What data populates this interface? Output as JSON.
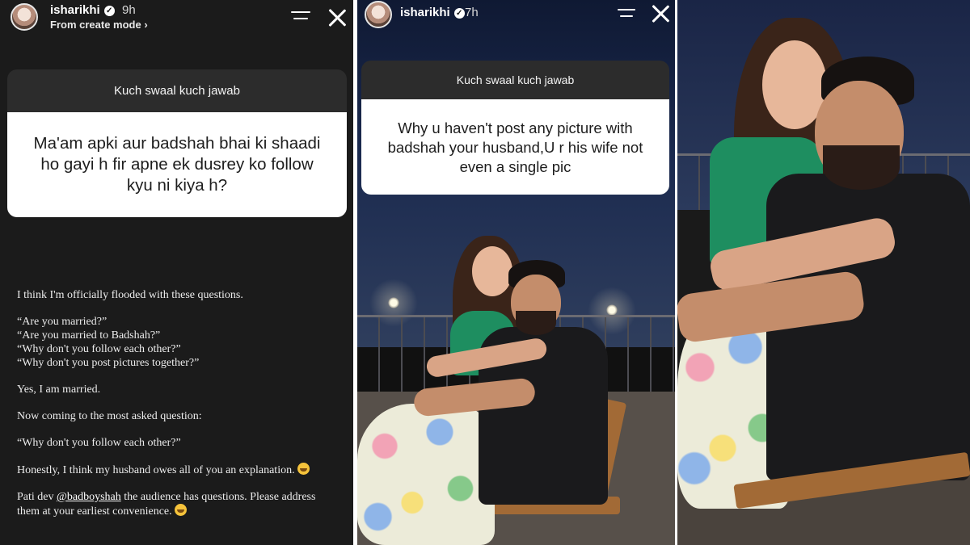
{
  "story1": {
    "username": "isharikhi",
    "time": "9h",
    "subline": "From create mode ›",
    "question_header": "Kuch swaal kuch jawab",
    "question_text": "Ma'am apki aur badshah bhai ki shaadi ho gayi h fir apne ek dusrey ko follow kyu ni kiya h?",
    "lines": {
      "l1": "I think I'm officially flooded with these questions.",
      "l2": "“Are you married?”",
      "l3": "“Are you married to Badshah?”",
      "l4": "“Why don't you follow each other?”",
      "l5": "“Why don't you post pictures together?”",
      "l6": "Yes, I am married.",
      "l7": "Now coming to the most asked question:",
      "l8": "“Why don't you follow each other?”",
      "l9": "Honestly, I think my husband owes all of you an explanation.",
      "l10_pre": "Pati dev ",
      "l10_mention": "@badboyshah",
      "l10_post": " the audience has questions. Please address",
      "l11": "them at your earliest convenience."
    }
  },
  "story2": {
    "username": "isharikhi",
    "time": "7h",
    "question_header": "Kuch swaal kuch jawab",
    "question_text": "Why u haven't post any picture with badshah your husband,U r his wife not even a single pic"
  },
  "icons": {
    "verified": "verified-badge-icon",
    "menu": "menu-lines-icon",
    "close": "close-icon",
    "emoji1": "grinning-face-icon",
    "emoji2": "rolling-laughing-face-icon"
  },
  "colors": {
    "story_bg": "#1b1b1b",
    "question_header_bg": "#2c2c2c",
    "question_body_bg": "#ffffff",
    "top_green": "#1e8e60"
  }
}
